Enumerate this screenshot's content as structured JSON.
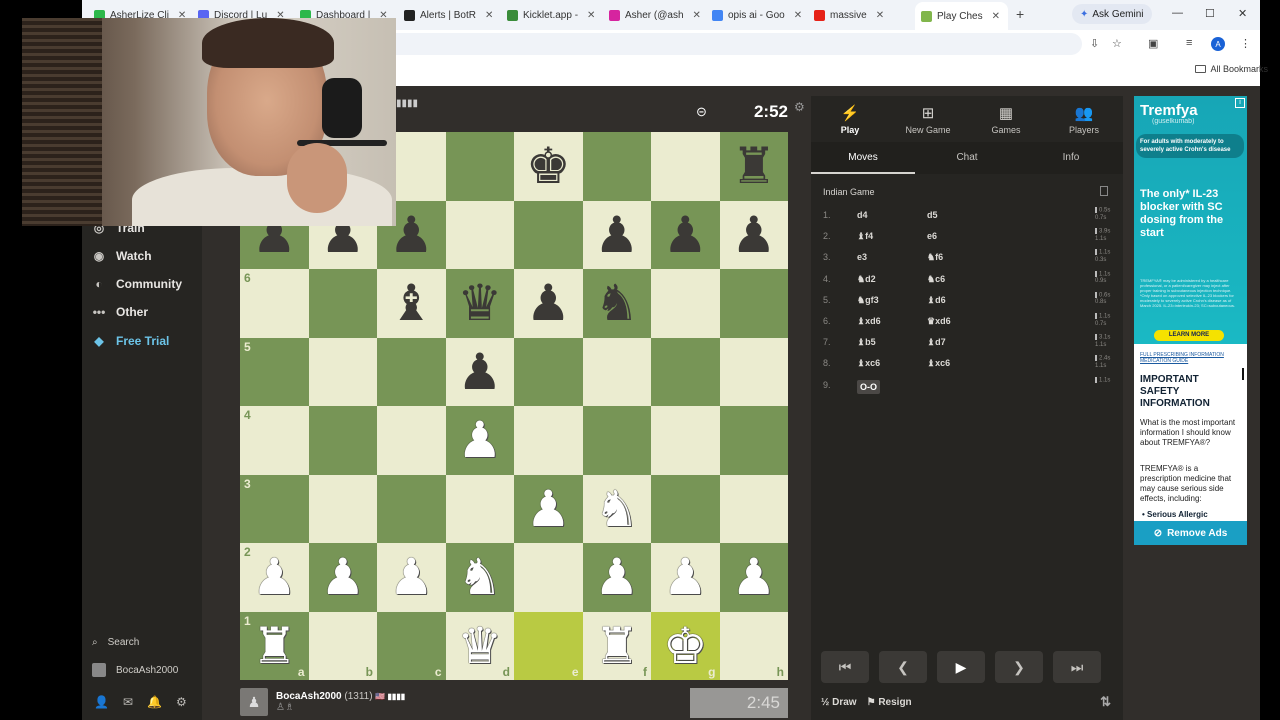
{
  "browser": {
    "tabs": [
      {
        "label": "AsherLize Cli",
        "color": "#2db84b"
      },
      {
        "label": "Discord | Lu",
        "color": "#5865f2"
      },
      {
        "label": "Dashboard | ",
        "color": "#2db84b"
      },
      {
        "label": "Alerts | BotR",
        "color": "#222222"
      },
      {
        "label": "Kicklet.app - ",
        "color": "#3a8c3a"
      },
      {
        "label": "Asher (@ash",
        "color": "#d6249f"
      },
      {
        "label": "opis ai - Goo",
        "color": "#4285f4"
      },
      {
        "label": "massive",
        "color": "#e62117"
      },
      {
        "label": "Play Ches",
        "color": "#81b64c"
      }
    ],
    "new_tab": "+",
    "gemini_label": "Ask Gemini",
    "profile_initial": "A",
    "bookmarks_label": "All Bookmarks"
  },
  "nav": {
    "items": [
      {
        "label": "Train",
        "icon": "train-icon",
        "glyph": "◎"
      },
      {
        "label": "Watch",
        "icon": "watch-icon",
        "glyph": "◉"
      },
      {
        "label": "Community",
        "icon": "community-icon",
        "glyph": "◐"
      },
      {
        "label": "Other",
        "icon": "more-icon",
        "glyph": "•••"
      },
      {
        "label": "Free Trial",
        "icon": "diamond-icon",
        "glyph": "◆"
      }
    ],
    "search_label": "Search",
    "user_label": "BocaAsh2000"
  },
  "game": {
    "top_clock": "2:52",
    "bottom_clock": "2:45",
    "bottom_player": {
      "name": "BocaAsh2000",
      "rating": "(1311)"
    }
  },
  "board": {
    "ranks": [
      "8",
      "7",
      "6",
      "5",
      "4",
      "3",
      "2",
      "1"
    ],
    "files": [
      "a",
      "b",
      "c",
      "d",
      "e",
      "f",
      "g",
      "h"
    ],
    "position": [
      [
        "",
        "",
        "",
        "",
        "bk",
        "",
        "",
        "br"
      ],
      [
        "bp",
        "bp",
        "bp",
        "",
        "",
        "bp",
        "bp",
        "bp"
      ],
      [
        "",
        "",
        "bb",
        "bq",
        "bp",
        "bn",
        "",
        ""
      ],
      [
        "",
        "",
        "",
        "bp",
        "",
        "",
        "",
        ""
      ],
      [
        "",
        "",
        "",
        "wp",
        "",
        "",
        "",
        ""
      ],
      [
        "",
        "",
        "",
        "",
        "wp",
        "wn",
        "",
        ""
      ],
      [
        "wp",
        "wp",
        "wp",
        "wn",
        "",
        "wp",
        "wp",
        "wp"
      ],
      [
        "wr",
        "",
        "",
        "wq",
        "",
        "wr",
        "wk",
        ""
      ]
    ],
    "highlight": [
      [
        7,
        4
      ],
      [
        7,
        6
      ]
    ]
  },
  "panel": {
    "tabs": [
      {
        "label": "Play",
        "glyph": "⚡"
      },
      {
        "label": "New Game",
        "glyph": "⊞"
      },
      {
        "label": "Games",
        "glyph": "▦"
      },
      {
        "label": "Players",
        "glyph": "👥"
      }
    ],
    "subtabs": [
      "Moves",
      "Chat",
      "Info"
    ],
    "opening": "Indian Game",
    "moves": [
      {
        "n": "1.",
        "w": "d4",
        "b": "d5",
        "t": [
          "0.5s",
          "0.7s"
        ]
      },
      {
        "n": "2.",
        "w": "♝f4",
        "b": "e6",
        "t": [
          "3.9s",
          "1.1s"
        ]
      },
      {
        "n": "3.",
        "w": "e3",
        "b": "♞f6",
        "t": [
          "1.1s",
          "0.3s"
        ]
      },
      {
        "n": "4.",
        "w": "♞d2",
        "b": "♞c6",
        "t": [
          "1.1s",
          "0.9s"
        ]
      },
      {
        "n": "5.",
        "w": "♞gf3",
        "b": "♝d6",
        "t": [
          "0.6s",
          "0.8s"
        ]
      },
      {
        "n": "6.",
        "w": "♝xd6",
        "b": "♛xd6",
        "t": [
          "1.1s",
          "0.7s"
        ]
      },
      {
        "n": "7.",
        "w": "♝b5",
        "b": "♝d7",
        "t": [
          "3.1s",
          "1.1s"
        ]
      },
      {
        "n": "8.",
        "w": "♝xc6",
        "b": "♝xc6",
        "t": [
          "2.4s",
          "1.1s"
        ]
      },
      {
        "n": "9.",
        "w": "O-O",
        "b": "",
        "t": [
          "1.1s",
          ""
        ]
      }
    ],
    "draw_label": "Draw",
    "resign_label": "Resign"
  },
  "ad": {
    "brand": "Tremfya",
    "brand_sub": "(guselkumab)",
    "pill": "For adults with moderately to severely active Crohn's disease",
    "headline": "The only* IL-23 blocker with SC dosing from the start",
    "fine": "TREMFYA® may be administered by a healthcare professional, or a patient/caregiver may inject after proper training in subcutaneous injection technique. *Only based on approved selective IL-23 blockers for moderately to severely active Crohn's disease as of March 2025. IL-23=interleukin-23; SC=subcutaneous.",
    "learn_more": "LEARN MORE",
    "pi_link": "FULL PRESCRIBING INFORMATION MEDICATION GUIDE",
    "isi": "IMPORTANT SAFETY INFORMATION",
    "body1": "What is the most important information I should know about TREMFYA®?",
    "body2": "TREMFYA® is a prescription medicine that may cause serious side effects, including:",
    "bullet": "Serious Allergic",
    "remove_ads": "Remove Ads",
    "accent": "#1ab9c4"
  }
}
